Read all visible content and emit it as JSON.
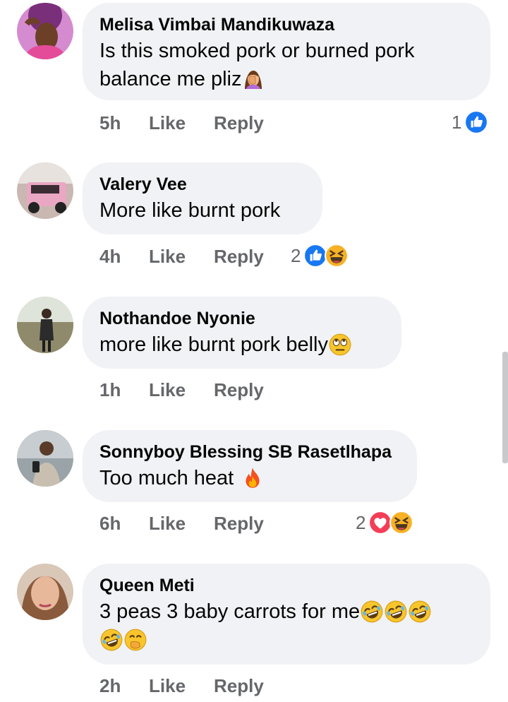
{
  "colors": {
    "bubble": "#f0f2f5",
    "meta_text": "#65676b",
    "like_blue": "#1877f2",
    "love_red": "#f33e58",
    "haha_yellow": "#f7b125"
  },
  "comments": [
    {
      "author": "Melisa Vimbai Mandikuwaza",
      "text_lines": [
        "Is this smoked pork or burned pork",
        "balance me pliz"
      ],
      "inline_emoji": [
        "facepalm-woman"
      ],
      "time": "5h",
      "like": "Like",
      "reply": "Reply",
      "reaction_count": "1",
      "reaction_icons": [
        "like-reaction"
      ]
    },
    {
      "author": "Valery Vee",
      "text_lines": [
        "More like burnt pork"
      ],
      "time": "4h",
      "like": "Like",
      "reply": "Reply",
      "reaction_count": "2",
      "reaction_icons": [
        "like-reaction",
        "haha-reaction"
      ]
    },
    {
      "author": "Nothandoe Nyonie",
      "text_lines": [
        "more like burnt pork belly"
      ],
      "inline_emoji": [
        "eye-roll-emoji"
      ],
      "time": "1h",
      "like": "Like",
      "reply": "Reply"
    },
    {
      "author": "Sonnyboy Blessing SB Rasetlhapa",
      "text_lines": [
        "Too much heat"
      ],
      "inline_emoji": [
        "fire-emoji"
      ],
      "time": "6h",
      "like": "Like",
      "reply": "Reply",
      "reaction_count": "2",
      "reaction_icons": [
        "love-reaction",
        "haha-reaction"
      ]
    },
    {
      "author": "Queen Meti",
      "text_lines": [
        "3 peas 3 baby carrots for me"
      ],
      "inline_emoji": [
        "rofl-emoji",
        "rofl-emoji",
        "rofl-emoji",
        "rofl-emoji",
        "hand-over-mouth-emoji"
      ],
      "time": "2h",
      "like": "Like",
      "reply": "Reply"
    }
  ]
}
